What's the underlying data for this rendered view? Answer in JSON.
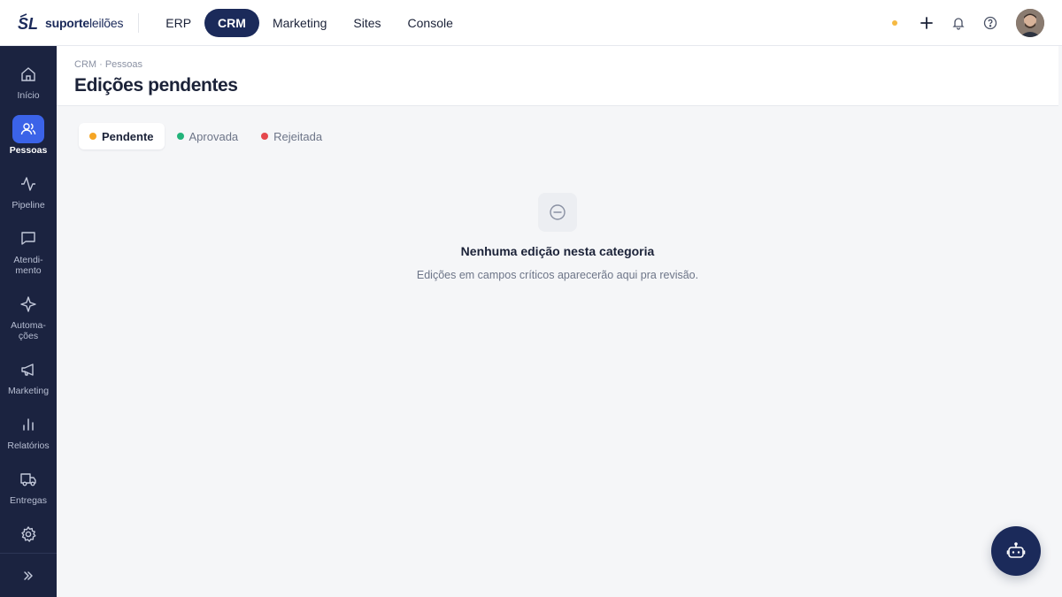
{
  "brand": {
    "mark": "SL",
    "name_bold": "suporte",
    "name_light": "leilões"
  },
  "topnav": {
    "tabs": [
      {
        "label": "ERP",
        "active": false
      },
      {
        "label": "CRM",
        "active": true
      },
      {
        "label": "Marketing",
        "active": false
      },
      {
        "label": "Sites",
        "active": false
      },
      {
        "label": "Console",
        "active": false
      }
    ]
  },
  "topbar_right": {
    "status_color": "#f5b942",
    "icons": [
      "plus-icon",
      "bell-icon",
      "help-icon"
    ]
  },
  "sidebar": {
    "items": [
      {
        "label": "Início",
        "icon": "home-icon",
        "active": false
      },
      {
        "label": "Pessoas",
        "icon": "users-icon",
        "active": true
      },
      {
        "label": "Pipeline",
        "icon": "activity-icon",
        "active": false
      },
      {
        "label": "Atendi-\nmento",
        "icon": "chat-icon",
        "active": false
      },
      {
        "label": "Automa-\nções",
        "icon": "sparkle-icon",
        "active": false
      },
      {
        "label": "Marketing",
        "icon": "megaphone-icon",
        "active": false
      },
      {
        "label": "Relatórios",
        "icon": "bar-chart-icon",
        "active": false
      },
      {
        "label": "Entregas",
        "icon": "truck-icon",
        "active": false
      },
      {
        "label": "",
        "icon": "gear-icon",
        "active": false
      }
    ],
    "collapse_icon": "chevrons-right-icon"
  },
  "header": {
    "breadcrumb": "CRM · Pessoas",
    "title": "Edições pendentes"
  },
  "filters": [
    {
      "label": "Pendente",
      "color": "#f5a524",
      "active": true
    },
    {
      "label": "Aprovada",
      "color": "#22b37a",
      "active": false
    },
    {
      "label": "Rejeitada",
      "color": "#e5484d",
      "active": false
    }
  ],
  "empty_state": {
    "icon": "minus-circle-icon",
    "title": "Nenhuma edição nesta categoria",
    "description": "Edições em campos críticos aparecerão aqui pra revisão."
  },
  "fab": {
    "icon": "bot-icon"
  },
  "colors": {
    "accent": "#3b63e8",
    "navy": "#1b2a5a",
    "sidebar": "#1b2340"
  }
}
